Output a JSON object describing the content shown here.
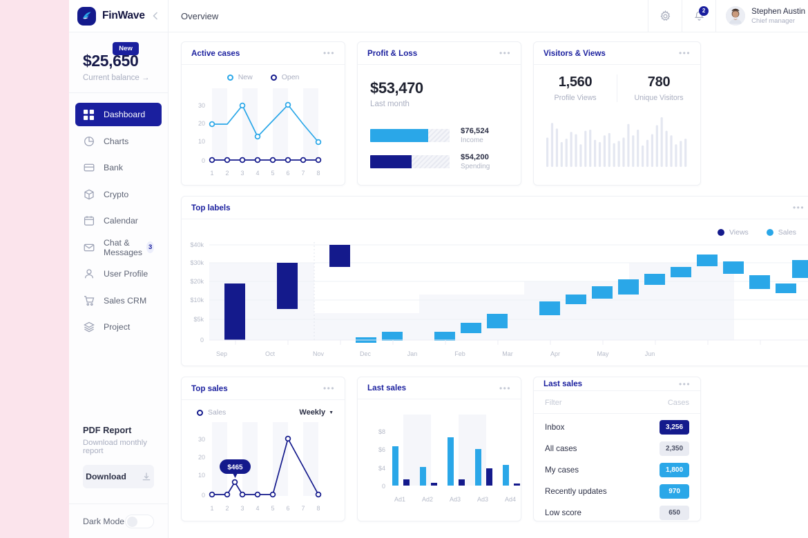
{
  "colors": {
    "navy": "#141a8c",
    "navy_dark": "#1a1f9e",
    "blue": "#2aa7e8",
    "grey_pill": "#e9ebf2",
    "page_bg": "#fbe4ec",
    "right_bg": "#ded9cd"
  },
  "sidebar": {
    "brand": "FinWave",
    "collapse_icon": "chevron-left-icon",
    "badge": "New",
    "balance_amount": "$25,650",
    "balance_label": "Current balance",
    "balance_arrow": "→",
    "items": [
      {
        "label": "Dashboard",
        "icon": "grid-icon",
        "active": true,
        "badge": ""
      },
      {
        "label": "Charts",
        "icon": "pie-chart-icon",
        "active": false,
        "badge": ""
      },
      {
        "label": "Bank",
        "icon": "card-icon",
        "active": false,
        "badge": ""
      },
      {
        "label": "Crypto",
        "icon": "cube-icon",
        "active": false,
        "badge": ""
      },
      {
        "label": "Calendar",
        "icon": "calendar-icon",
        "active": false,
        "badge": ""
      },
      {
        "label": "Chat & Messages",
        "icon": "mail-icon",
        "active": false,
        "badge": "3"
      },
      {
        "label": "User Profile",
        "icon": "user-icon",
        "active": false,
        "badge": ""
      },
      {
        "label": "Sales CRM",
        "icon": "cart-icon",
        "active": false,
        "badge": ""
      },
      {
        "label": "Project",
        "icon": "layers-icon",
        "active": false,
        "badge": ""
      }
    ],
    "pdf_title": "PDF Report",
    "pdf_sub": "Download monthly report",
    "download_label": "Download",
    "download_icon": "download-icon",
    "dark_mode_label": "Dark Mode",
    "dark_mode_on": false
  },
  "topbar": {
    "page_title": "Overview",
    "settings_icon": "gear-icon",
    "bell_icon": "bell-icon",
    "notification_count": "2",
    "user_name": "Stephen Austin",
    "user_role": "Chief manager",
    "caret_icon": "chevron-down-icon"
  },
  "cards": {
    "active_cases": {
      "title": "Active cases",
      "menu_icon": "more-icon"
    },
    "profit_loss": {
      "title": "Profit & Loss",
      "menu_icon": "more-icon",
      "amount": "$53,470",
      "subtitle": "Last month",
      "bars": [
        {
          "value": "$76,524",
          "name": "Income",
          "pct": 73,
          "color": "#2aa7e8"
        },
        {
          "value": "$54,200",
          "name": "Spending",
          "pct": 52,
          "color": "#141a8c"
        }
      ]
    },
    "visitors": {
      "title": "Visitors & Views",
      "menu_icon": "more-icon",
      "stats": [
        {
          "value": "1,560",
          "label": "Profile Views"
        },
        {
          "value": "780",
          "label": "Unique Visitors"
        }
      ]
    },
    "top_labels": {
      "title": "Top labels",
      "menu_icon": "more-icon"
    },
    "top_sales": {
      "title": "Top sales",
      "menu_icon": "more-icon",
      "period": "Weekly",
      "period_caret": "chevron-down-icon",
      "tooltip": "$465"
    },
    "last_sales_chart": {
      "title": "Last sales",
      "menu_icon": "more-icon"
    },
    "last_sales_list": {
      "title": "Last sales",
      "menu_icon": "more-icon",
      "col_filter": "Filter",
      "col_cases": "Cases",
      "rows": [
        {
          "name": "Inbox",
          "value": "3,256",
          "style": "navy"
        },
        {
          "name": "All cases",
          "value": "2,350",
          "style": "grey"
        },
        {
          "name": "My cases",
          "value": "1,800",
          "style": "blue"
        },
        {
          "name": "Recently updates",
          "value": "970",
          "style": "blue"
        },
        {
          "name": "Low score",
          "value": "650",
          "style": "grey"
        }
      ]
    }
  },
  "chart_data": [
    {
      "id": "active_cases",
      "type": "line",
      "title": "Active cases",
      "x": [
        1,
        2,
        3,
        4,
        5,
        6,
        7,
        8
      ],
      "xlabel": "",
      "ylabel": "",
      "yticks": [
        0,
        10,
        20,
        30
      ],
      "ylim": [
        0,
        34
      ],
      "grid": false,
      "legend_position": "top",
      "series": [
        {
          "name": "New",
          "color": "#2aa7e8",
          "values": [
            20,
            20,
            30,
            14,
            22,
            30,
            20,
            10
          ]
        },
        {
          "name": "Open",
          "color": "#141a8c",
          "values": [
            0,
            0,
            0,
            0,
            0,
            0,
            0,
            0
          ]
        }
      ]
    },
    {
      "id": "profit_loss",
      "type": "bar",
      "title": "Profit & Loss",
      "orientation": "horizontal",
      "categories": [
        "Income",
        "Spending"
      ],
      "values": [
        76524,
        54200
      ],
      "value_labels": [
        "$76,524",
        "$54,200"
      ],
      "fill_pct": [
        73,
        52
      ],
      "colors": [
        "#2aa7e8",
        "#141a8c"
      ],
      "headline": "$53,470",
      "headline_sub": "Last month"
    },
    {
      "id": "visitors_sparkline",
      "type": "bar",
      "title": "Visitors & Views",
      "color": "#e4e7f1",
      "ylim": [
        0,
        100
      ],
      "values": [
        52,
        78,
        68,
        44,
        50,
        62,
        58,
        40,
        64,
        66,
        48,
        44,
        56,
        60,
        42,
        46,
        52,
        76,
        56,
        66,
        38,
        48,
        58,
        74,
        88,
        64,
        56,
        40,
        46,
        50
      ]
    },
    {
      "id": "top_labels",
      "type": "bar",
      "subtype": "floating-range",
      "title": "Top labels",
      "xlabel": "",
      "ylabel": "",
      "categories": [
        "Sep",
        "Oct",
        "Nov",
        "Dec",
        "Jan",
        "Feb",
        "Mar",
        "Apr",
        "May",
        "Jun"
      ],
      "yticks": [
        "0",
        "$5k",
        "$10k",
        "$20k",
        "$30k",
        "$40k"
      ],
      "grid": true,
      "legend_position": "top-right",
      "legend": [
        {
          "name": "Views",
          "color": "#141a8c"
        },
        {
          "name": "Sales",
          "color": "#2aa7e8"
        }
      ],
      "bars": [
        {
          "month": "Sep",
          "low": 1.9,
          "high": 20.0,
          "series": "Views"
        },
        {
          "month": "Sep",
          "low": 13.2,
          "high": 32.0,
          "series": "Views"
        },
        {
          "month": "Oct",
          "low": 29.0,
          "high": 43.0,
          "series": "Views"
        },
        {
          "month": "Oct",
          "low": 0.2,
          "high": 1.9,
          "series": "Sales"
        },
        {
          "month": "Nov",
          "low": 0.2,
          "high": 1.9,
          "series": "Sales"
        },
        {
          "month": "Nov",
          "low": 2.6,
          "high": 5.8,
          "series": "Sales"
        },
        {
          "month": "Dec",
          "low": 6.0,
          "high": 9.4,
          "series": "Sales"
        },
        {
          "month": "Dec",
          "low": 9.8,
          "high": 11.6,
          "series": "Sales"
        },
        {
          "month": "Jan",
          "low": 13.0,
          "high": 19.0,
          "series": "Sales"
        },
        {
          "month": "Jan",
          "low": 18.0,
          "high": 22.5,
          "series": "Sales"
        },
        {
          "month": "Feb",
          "low": 21.0,
          "high": 25.0,
          "series": "Sales"
        },
        {
          "month": "Feb",
          "low": 27.0,
          "high": 32.0,
          "series": "Sales"
        },
        {
          "month": "Mar",
          "low": 24.0,
          "high": 29.0,
          "series": "Sales"
        },
        {
          "month": "Mar",
          "low": 17.5,
          "high": 23.0,
          "series": "Sales"
        },
        {
          "month": "Apr",
          "low": 15.0,
          "high": 18.5,
          "series": "Sales"
        },
        {
          "month": "Apr",
          "low": 12.5,
          "high": 16.0,
          "series": "Sales"
        },
        {
          "month": "May",
          "low": 15.5,
          "high": 20.0,
          "series": "Sales"
        },
        {
          "month": "May",
          "low": 19.0,
          "high": 23.0,
          "series": "Sales"
        },
        {
          "month": "Jun",
          "low": 23.0,
          "high": 29.5,
          "series": "Sales"
        }
      ]
    },
    {
      "id": "top_sales",
      "type": "line",
      "title": "Top sales",
      "x": [
        1,
        2,
        3,
        4,
        5,
        6,
        7,
        8
      ],
      "yticks": [
        0,
        10,
        20,
        30
      ],
      "ylim": [
        0,
        34
      ],
      "annotation": {
        "text": "$465",
        "x": 2.5,
        "y": 7
      },
      "legend_position": "top-left",
      "series": [
        {
          "name": "Sales",
          "color": "#141a8c",
          "values": [
            0,
            0,
            7,
            0,
            0,
            0,
            30,
            0
          ]
        }
      ]
    },
    {
      "id": "last_sales",
      "type": "bar",
      "title": "Last sales",
      "categories": [
        "Ad1",
        "Ad2",
        "Ad3",
        "Ad3",
        "Ad4"
      ],
      "yticks": [
        "0",
        "$4",
        "$6",
        "$8"
      ],
      "ylim": [
        0,
        9
      ],
      "series": [
        {
          "name": "Sales",
          "color": "#2aa7e8",
          "values": [
            6.6,
            4.3,
            7.7,
            6.2,
            4.5
          ]
        },
        {
          "name": "Views",
          "color": "#141a8c",
          "values": [
            0.7,
            0.3,
            0.7,
            2.0,
            0.2
          ]
        }
      ]
    }
  ]
}
